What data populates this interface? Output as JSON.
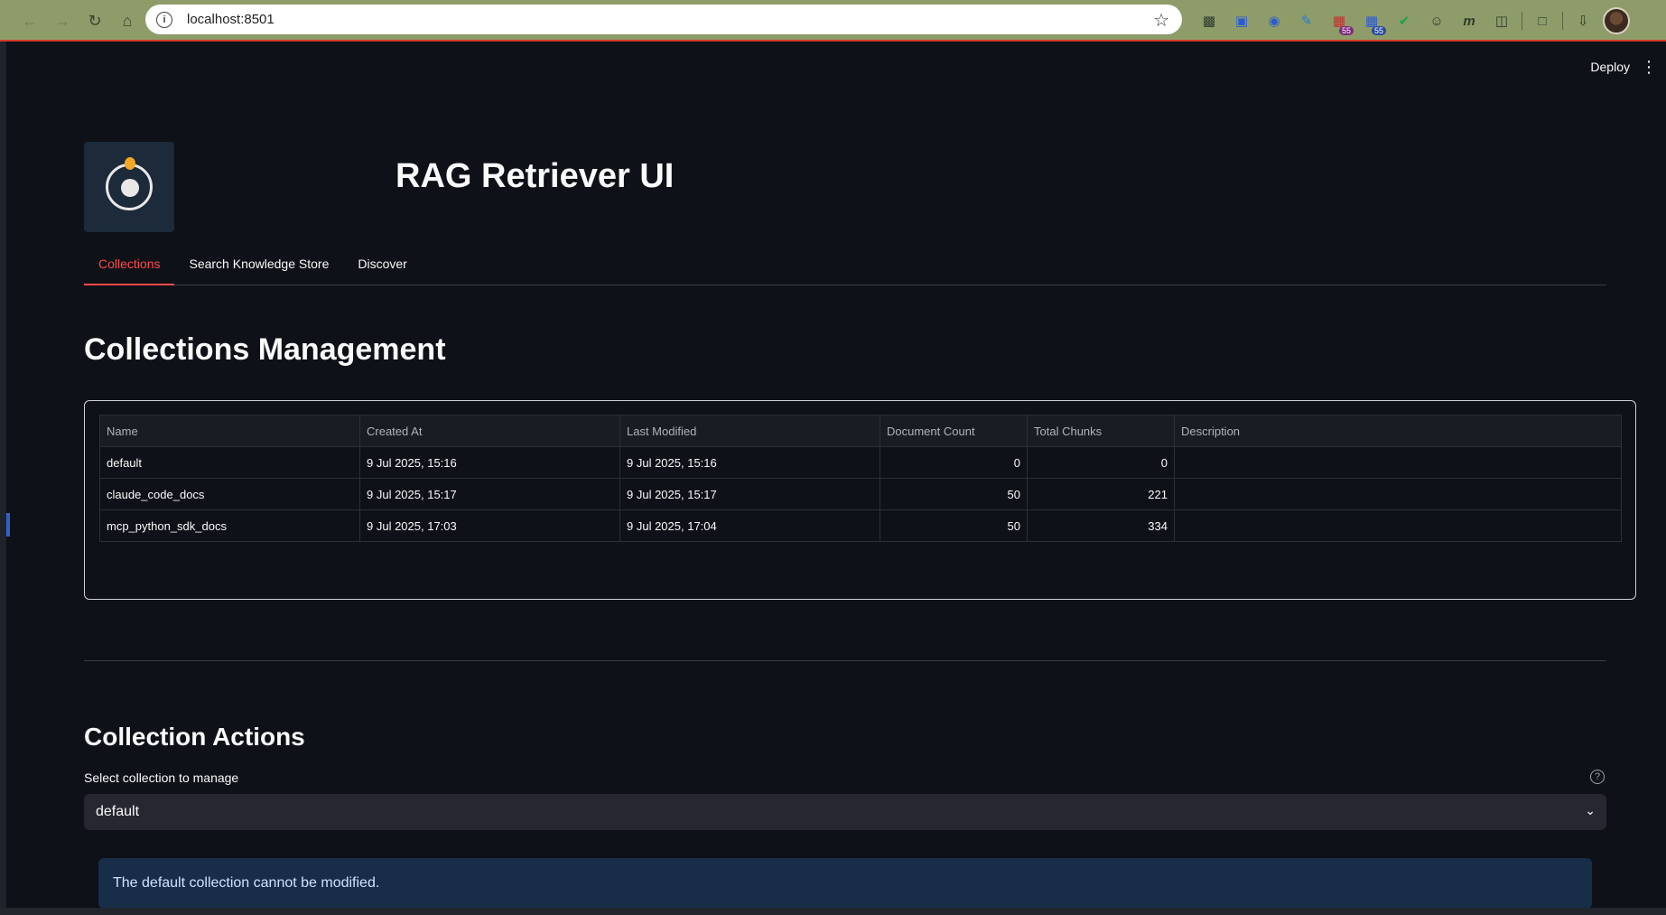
{
  "browser": {
    "url": "localhost:8501",
    "extension_badges": [
      "55",
      "55"
    ]
  },
  "header": {
    "deploy_label": "Deploy"
  },
  "app_title": "RAG Retriever UI",
  "tabs": [
    {
      "label": "Collections",
      "active": true
    },
    {
      "label": "Search Knowledge Store",
      "active": false
    },
    {
      "label": "Discover",
      "active": false
    }
  ],
  "collections": {
    "heading": "Collections Management",
    "columns": [
      "Name",
      "Created At",
      "Last Modified",
      "Document Count",
      "Total Chunks",
      "Description"
    ],
    "rows": [
      [
        "default",
        "9 Jul 2025, 15:16",
        "9 Jul 2025, 15:16",
        "0",
        "0",
        ""
      ],
      [
        "claude_code_docs",
        "9 Jul 2025, 15:17",
        "9 Jul 2025, 15:17",
        "50",
        "221",
        ""
      ],
      [
        "mcp_python_sdk_docs",
        "9 Jul 2025, 17:03",
        "9 Jul 2025, 17:04",
        "50",
        "334",
        ""
      ]
    ]
  },
  "actions": {
    "heading": "Collection Actions",
    "select_label": "Select collection to manage",
    "selected_value": "default",
    "info_message": "The default collection cannot be modified."
  },
  "colors": {
    "accent": "#ff4b4b",
    "background": "#0e1117",
    "info_bg": "#172d48"
  }
}
